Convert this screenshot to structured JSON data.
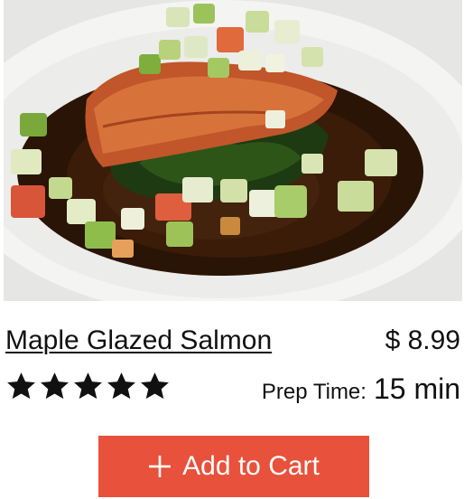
{
  "product": {
    "name": "Maple Glazed Salmon",
    "price": "$ 8.99",
    "rating": 5,
    "rating_max": 5,
    "prep_label": "Prep Time:",
    "prep_value": "15 min"
  },
  "actions": {
    "add_to_cart_label": "Add to Cart",
    "add_icon": "plus-icon"
  },
  "colors": {
    "accent": "#e8513b",
    "text": "#111111",
    "background": "#ffffff"
  }
}
